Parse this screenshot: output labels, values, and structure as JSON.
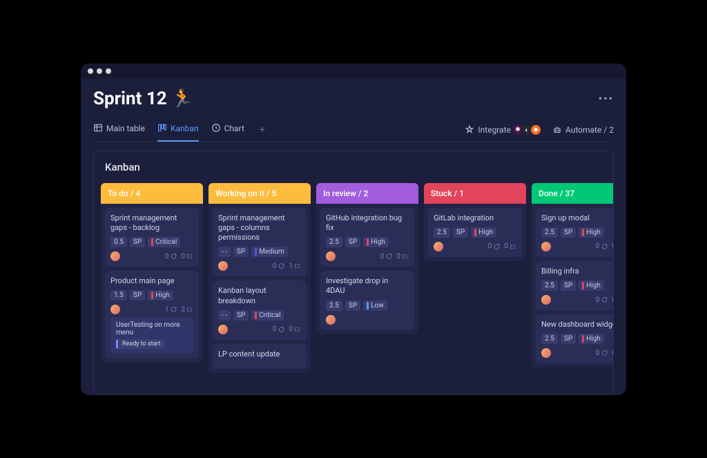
{
  "header": {
    "title": "Sprint 12",
    "emoji": "🏃"
  },
  "tabs": [
    {
      "label": "Main table",
      "icon": "table",
      "active": false
    },
    {
      "label": "Kanban",
      "icon": "kanban",
      "active": true
    },
    {
      "label": "Chart",
      "icon": "clock",
      "active": false
    }
  ],
  "actions": {
    "integrate_label": "Integrate",
    "automate_label": "Automate / 2",
    "integrations": [
      "slack",
      "github",
      "gitlab"
    ]
  },
  "board": {
    "title": "Kanban",
    "columns": [
      {
        "label": "To do / 4",
        "color": "#fdbc3d",
        "cards": [
          {
            "title": "Sprint management gaps - backlog",
            "sp": "0.5",
            "sp_label": "SP",
            "priority": "Critical",
            "priority_color": "#e2445c",
            "comments": 0,
            "subitems": 0,
            "extras": 0
          },
          {
            "title": "Product main page",
            "sp": "1.5",
            "sp_label": "SP",
            "priority": "High",
            "priority_color": "#e2445c",
            "comments": 1,
            "subitems": 2,
            "extras": 0,
            "subcard": {
              "title": "UserTesting on more menu",
              "status": "Ready to start"
            }
          }
        ]
      },
      {
        "label": "Working on it / 5",
        "color": "#fdbc3d",
        "cards": [
          {
            "title": "Sprint management gaps - columns permissions",
            "sp": "- -",
            "sp_label": "SP",
            "priority": "Medium",
            "priority_color": "#5559df",
            "comments": 0,
            "subitems": 1,
            "extras": 0
          },
          {
            "title": "Kanban layout breakdown",
            "sp": "- -",
            "sp_label": "SP",
            "priority": "Critical",
            "priority_color": "#e2445c",
            "comments": 0,
            "subitems": 0,
            "extras": 0
          },
          {
            "title": "LP content update",
            "partial": true
          }
        ]
      },
      {
        "label": "In review / 2",
        "color": "#a25ddc",
        "cards": [
          {
            "title": "GitHub integration bug fix",
            "sp": "2.5",
            "sp_label": "SP",
            "priority": "High",
            "priority_color": "#e2445c",
            "comments": 0,
            "subitems": 0,
            "extras": 0
          },
          {
            "title": "Investigate drop in 4DAU",
            "sp": "2.5",
            "sp_label": "SP",
            "priority": "Low",
            "priority_color": "#579bfc",
            "comments": 0,
            "subitems": 0,
            "extras": 0,
            "no_footer_meta": true
          }
        ]
      },
      {
        "label": "Stuck / 1",
        "color": "#e2445c",
        "cards": [
          {
            "title": "GitLab integration",
            "sp": "2.5",
            "sp_label": "SP",
            "priority": "High",
            "priority_color": "#e2445c",
            "comments": 0,
            "subitems": 0,
            "extras": 0
          }
        ]
      },
      {
        "label": "Done / 37",
        "color": "#00c875",
        "cards": [
          {
            "title": "Sign up modal",
            "sp": "2.5",
            "sp_label": "SP",
            "priority": "High",
            "priority_color": "#e2445c",
            "comments": 0,
            "subitems": 0,
            "extras": 0
          },
          {
            "title": "Billing infra",
            "sp": "2.5",
            "sp_label": "SP",
            "priority": "High",
            "priority_color": "#e2445c",
            "comments": 0,
            "subitems": 0,
            "extras": 0
          },
          {
            "title": "New dashboard widget",
            "sp": "2.5",
            "sp_label": "SP",
            "priority": "High",
            "priority_color": "#e2445c",
            "comments": 0,
            "subitems": 0,
            "extras": 0,
            "partial_footer": true
          }
        ]
      }
    ]
  }
}
